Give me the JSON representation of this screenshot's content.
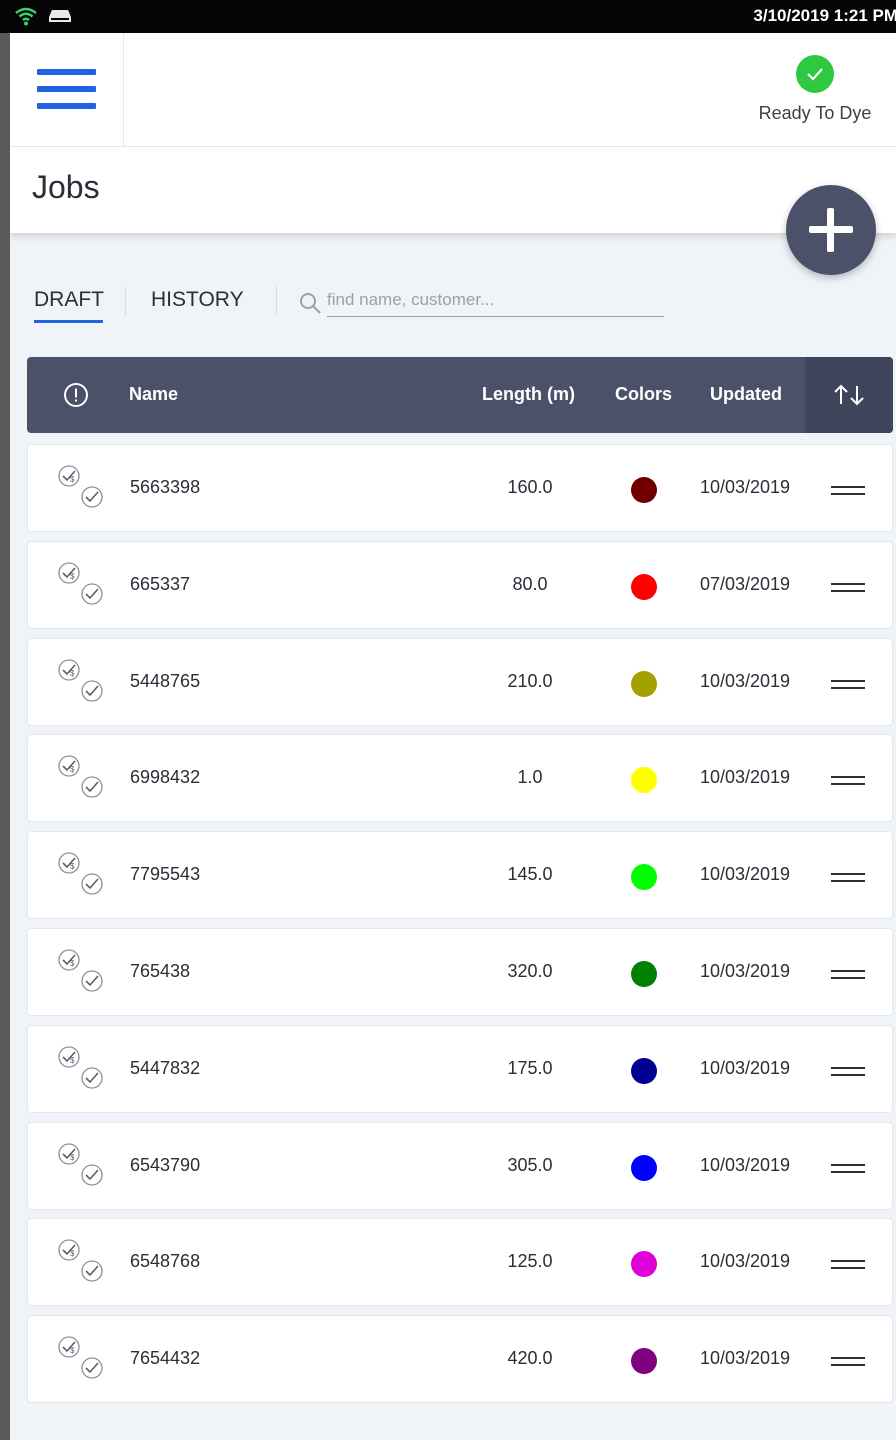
{
  "status_bar": {
    "clock": "3/10/2019 1:21 PM"
  },
  "header": {
    "status_label": "Ready To Dye",
    "status_color": "#2ec940",
    "accent_color": "#1f63e0"
  },
  "page": {
    "title": "Jobs"
  },
  "tabs": [
    {
      "label": "DRAFT",
      "selected": true
    },
    {
      "label": "HISTORY",
      "selected": false
    }
  ],
  "search": {
    "placeholder": "find name, customer...",
    "value": ""
  },
  "table": {
    "columns": {
      "name": "Name",
      "length": "Length (m)",
      "colors": "Colors",
      "updated": "Updated"
    },
    "sort_icon": "sort-arrows-icon",
    "rows": [
      {
        "name": "5663398",
        "length": "160.0",
        "color": "#700000",
        "updated": "10/03/2019"
      },
      {
        "name": "665337",
        "length": "80.0",
        "color": "#ff0000",
        "updated": "07/03/2019"
      },
      {
        "name": "5448765",
        "length": "210.0",
        "color": "#a3a000",
        "updated": "10/03/2019"
      },
      {
        "name": "6998432",
        "length": "1.0",
        "color": "#ffff00",
        "updated": "10/03/2019"
      },
      {
        "name": "7795543",
        "length": "145.0",
        "color": "#00ff00",
        "updated": "10/03/2019"
      },
      {
        "name": "765438",
        "length": "320.0",
        "color": "#008000",
        "updated": "10/03/2019"
      },
      {
        "name": "5447832",
        "length": "175.0",
        "color": "#000090",
        "updated": "10/03/2019"
      },
      {
        "name": "6543790",
        "length": "305.0",
        "color": "#0000ff",
        "updated": "10/03/2019"
      },
      {
        "name": "6548768",
        "length": "125.0",
        "color": "#e000d8",
        "updated": "10/03/2019"
      },
      {
        "name": "7654432",
        "length": "420.0",
        "color": "#800080",
        "updated": "10/03/2019"
      }
    ]
  }
}
